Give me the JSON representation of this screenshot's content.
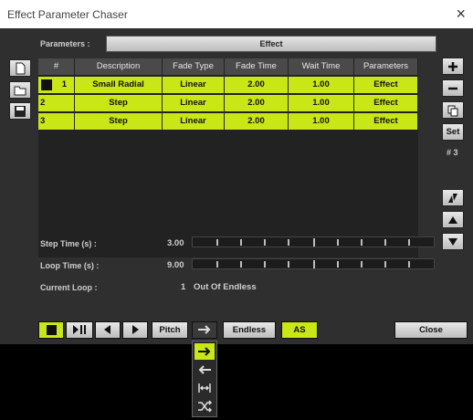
{
  "window": {
    "title": "Effect Parameter Chaser",
    "close_icon": "×"
  },
  "parameters": {
    "label": "Parameters :",
    "value": "Effect"
  },
  "table": {
    "headers": [
      "#",
      "Description",
      "Fade Type",
      "Fade Time",
      "Wait Time",
      "Parameters"
    ],
    "rows": [
      {
        "num": "1",
        "description": "Small Radial",
        "fade_type": "Linear",
        "fade_time": "2.00",
        "wait_time": "1.00",
        "parameters": "Effect"
      },
      {
        "num": "2",
        "description": "Step",
        "fade_type": "Linear",
        "fade_time": "2.00",
        "wait_time": "1.00",
        "parameters": "Effect"
      },
      {
        "num": "3",
        "description": "Step",
        "fade_type": "Linear",
        "fade_time": "2.00",
        "wait_time": "1.00",
        "parameters": "Effect"
      }
    ]
  },
  "right_panel": {
    "set_label": "Set",
    "count": "# 3"
  },
  "step_time": {
    "label": "Step Time (s) :",
    "value": "3.00"
  },
  "loop_time": {
    "label": "Loop Time (s) :",
    "value": "9.00"
  },
  "current_loop": {
    "label": "Current Loop :",
    "value": "1",
    "suffix": "Out Of Endless"
  },
  "toolbar": {
    "pitch": "Pitch",
    "endless": "Endless",
    "as": "AS",
    "close": "Close"
  },
  "colors": {
    "accent": "#c9e616",
    "panel": "#2f2f2f",
    "header": "#4a4a4a"
  }
}
